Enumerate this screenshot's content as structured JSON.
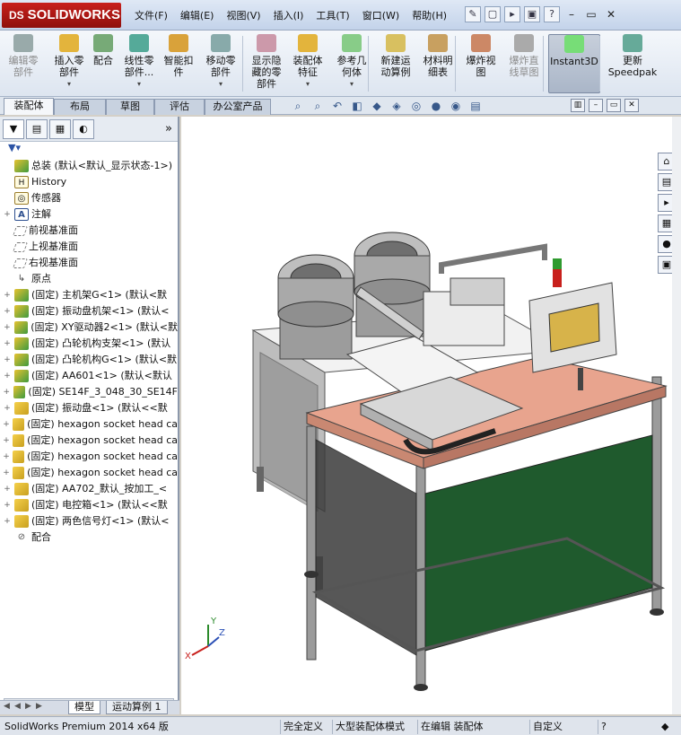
{
  "app": {
    "logo_text": "SOLIDWORKS",
    "logo_mark": "DS"
  },
  "menu": [
    "文件(F)",
    "编辑(E)",
    "视图(V)",
    "插入(I)",
    "工具(T)",
    "窗口(W)",
    "帮助(H)"
  ],
  "commands": [
    {
      "label": "编辑零\n部件",
      "enabled": false
    },
    {
      "label": "插入零\n部件",
      "enabled": true,
      "dropdown": true
    },
    {
      "label": "配合",
      "enabled": true
    },
    {
      "label": "线性零\n部件...",
      "enabled": true,
      "dropdown": true
    },
    {
      "label": "智能扣\n件",
      "enabled": true
    },
    {
      "label": "移动零\n部件",
      "enabled": true,
      "dropdown": true
    },
    {
      "label": "显示隐\n藏的零\n部件",
      "enabled": true
    },
    {
      "label": "装配体\n特征",
      "enabled": true,
      "dropdown": true
    },
    {
      "label": "参考几\n何体",
      "enabled": true,
      "dropdown": true
    },
    {
      "label": "新建运\n动算例",
      "enabled": true
    },
    {
      "label": "材料明\n细表",
      "enabled": true
    },
    {
      "label": "爆炸视\n图",
      "enabled": true
    },
    {
      "label": "爆炸直\n线草图",
      "enabled": false
    },
    {
      "label": "Instant3D",
      "enabled": true,
      "active": true
    },
    {
      "label": "更新\nSpeedpak",
      "enabled": true
    }
  ],
  "tabs": [
    "装配体",
    "布局",
    "草图",
    "评估",
    "办公室产品"
  ],
  "active_tab": "装配体",
  "panel": {
    "more": "»"
  },
  "tree": [
    {
      "label": "总装  (默认<默认_显示状态-1>)",
      "icon": "asm",
      "expand": "",
      "indent": 0
    },
    {
      "label": "History",
      "icon": "hist",
      "expand": "",
      "indent": 1
    },
    {
      "label": "传感器",
      "icon": "sens",
      "expand": "",
      "indent": 1
    },
    {
      "label": "注解",
      "icon": "note",
      "expand": "+",
      "indent": 1
    },
    {
      "label": "前视基准面",
      "icon": "plane",
      "expand": "",
      "indent": 1
    },
    {
      "label": "上视基准面",
      "icon": "plane",
      "expand": "",
      "indent": 1
    },
    {
      "label": "右视基准面",
      "icon": "plane",
      "expand": "",
      "indent": 1
    },
    {
      "label": "原点",
      "icon": "origin",
      "expand": "",
      "indent": 1
    },
    {
      "label": "(固定) 主机架G<1> (默认<默",
      "icon": "asm",
      "expand": "+",
      "indent": 1
    },
    {
      "label": "(固定) 振动盘机架<1> (默认<",
      "icon": "asm",
      "expand": "+",
      "indent": 1
    },
    {
      "label": "(固定) XY驱动器2<1> (默认<默",
      "icon": "asm",
      "expand": "+",
      "indent": 1
    },
    {
      "label": "(固定) 凸轮机构支架<1> (默认",
      "icon": "asm",
      "expand": "+",
      "indent": 1
    },
    {
      "label": "(固定) 凸轮机构G<1> (默认<默",
      "icon": "asm",
      "expand": "+",
      "indent": 1
    },
    {
      "label": "(固定) AA601<1> (默认<默认",
      "icon": "asm",
      "expand": "+",
      "indent": 1
    },
    {
      "label": "(固定) SE14F_3_048_30_SE14F",
      "icon": "asm",
      "expand": "+",
      "indent": 1
    },
    {
      "label": "(固定) 振动盘<1> (默认<<默",
      "icon": "part",
      "expand": "+",
      "indent": 1
    },
    {
      "label": "(固定) hexagon socket head ca",
      "icon": "part",
      "expand": "+",
      "indent": 1
    },
    {
      "label": "(固定) hexagon socket head ca",
      "icon": "part",
      "expand": "+",
      "indent": 1
    },
    {
      "label": "(固定) hexagon socket head ca",
      "icon": "part",
      "expand": "+",
      "indent": 1
    },
    {
      "label": "(固定) hexagon socket head ca",
      "icon": "part",
      "expand": "+",
      "indent": 1
    },
    {
      "label": "(固定) AA702_默认_按加工_<",
      "icon": "part",
      "expand": "+",
      "indent": 1
    },
    {
      "label": "(固定) 电控箱<1> (默认<<默",
      "icon": "part",
      "expand": "+",
      "indent": 1
    },
    {
      "label": "(固定) 两色信号灯<1> (默认<",
      "icon": "part",
      "expand": "+",
      "indent": 1
    },
    {
      "label": "配合",
      "icon": "mate",
      "expand": "",
      "indent": 1
    }
  ],
  "bottom_tabs": [
    "模型",
    "运动算例 1"
  ],
  "active_bottom_tab": "模型",
  "triad": {
    "x": "X",
    "y": "Y",
    "z": "Z"
  },
  "status": {
    "product": "SolidWorks Premium 2014 x64 版",
    "definition": "完全定义",
    "mode": "大型装配体模式",
    "editing": "在编辑 装配体",
    "custom": "自定义",
    "help": "?"
  },
  "colors": {
    "accent": "#c8201c",
    "table_top": "#e8a48e",
    "green_panel": "#1f5a2d"
  }
}
